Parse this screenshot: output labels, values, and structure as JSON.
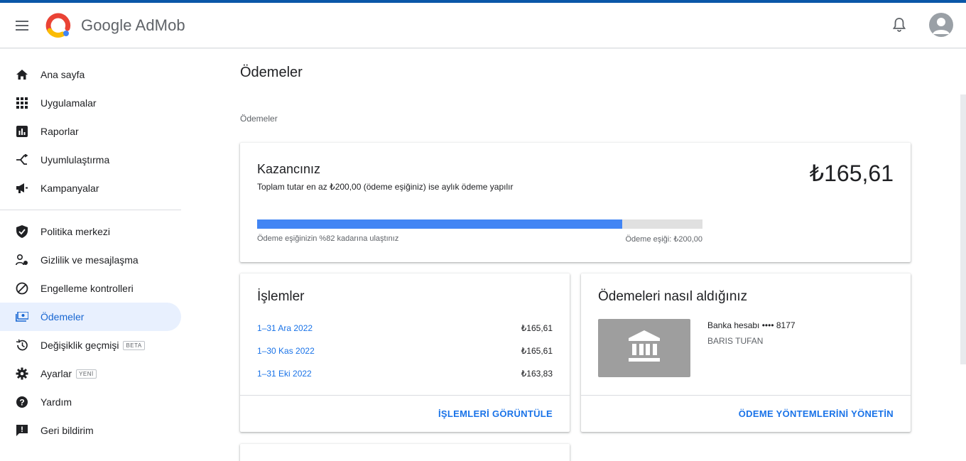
{
  "app": {
    "brand": "Google AdMob"
  },
  "sidebar": {
    "items": [
      {
        "label": "Ana sayfa"
      },
      {
        "label": "Uygulamalar"
      },
      {
        "label": "Raporlar"
      },
      {
        "label": "Uyumlulaştırma"
      },
      {
        "label": "Kampanyalar"
      },
      {
        "label": "Politika merkezi"
      },
      {
        "label": "Gizlilik ve mesajlaşma"
      },
      {
        "label": "Engelleme kontrolleri"
      },
      {
        "label": "Ödemeler"
      },
      {
        "label": "Değişiklik geçmişi",
        "tag": "BETA"
      },
      {
        "label": "Ayarlar",
        "tag": "YENİ"
      },
      {
        "label": "Yardım"
      },
      {
        "label": "Geri bildirim"
      }
    ]
  },
  "main": {
    "title": "Ödemeler",
    "breadcrumb": "Ödemeler",
    "earnings": {
      "title": "Kazancınız",
      "subtitle": "Toplam tutar en az ₺200,00 (ödeme eşiğiniz) ise aylık ödeme yapılır",
      "amount": "₺165,61",
      "progress_percent": 82,
      "progress_label": "Ödeme eşiğinizin %82 kadarına ulaştınız",
      "threshold_label": "Ödeme eşiği: ₺200,00"
    },
    "transactions": {
      "title": "İşlemler",
      "rows": [
        {
          "period": "1–31 Ara 2022",
          "amount": "₺165,61"
        },
        {
          "period": "1–30 Kas 2022",
          "amount": "₺165,61"
        },
        {
          "period": "1–31 Eki 2022",
          "amount": "₺163,83"
        }
      ],
      "action": "İŞLEMLERİ GÖRÜNTÜLE"
    },
    "payment_method": {
      "title": "Ödemeleri nasıl aldığınız",
      "account": "Banka hesabı •••• 8177",
      "holder": "BARIS TUFAN",
      "action": "ÖDEME YÖNTEMLERİNİ YÖNETİN"
    }
  },
  "colors": {
    "accent": "#1a73e8",
    "progress_fill": "#4285f4",
    "active_nav_bg": "#e8f0fe",
    "top_stripe": "#0b57a8"
  }
}
